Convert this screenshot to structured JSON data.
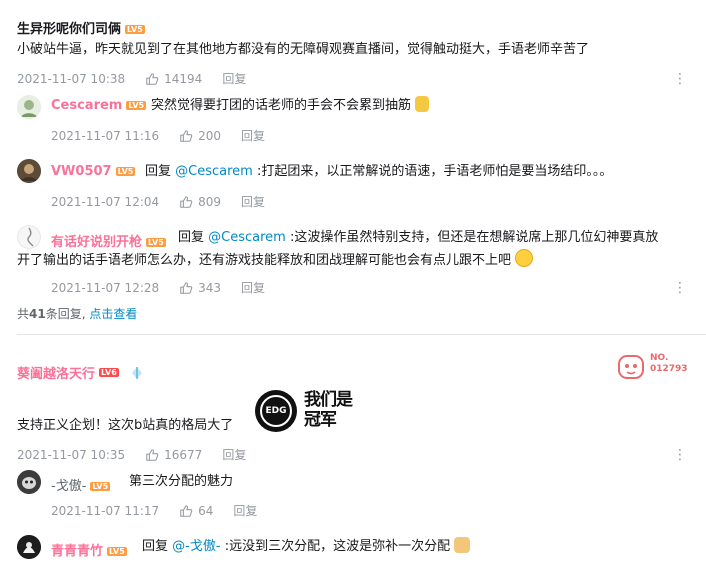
{
  "comment1": {
    "username": "生异形呢你们司俩",
    "level": "LV5",
    "text": "小破站牛逼，昨天就见到了在其他地方都没有的无障碍观赛直播间，觉得触动挺大，手语老师辛苦了",
    "time": "2021-11-07 10:38",
    "likes": "14194",
    "reply_label": "回复"
  },
  "replies1": [
    {
      "username": "Cescarem",
      "level": "LV5",
      "text": "突然觉得要打团的话老师的手会不会累到抽筋",
      "time": "2021-11-07 11:16",
      "likes": "200",
      "reply_label": "回复"
    },
    {
      "username": "VW0507",
      "level": "LV5",
      "reply_prefix": "回复",
      "at": "@Cescarem",
      "text": ":打起团来，以正常解说的语速，手语老师怕是要当场结印。。。",
      "time": "2021-11-07 12:04",
      "likes": "809",
      "reply_label": "回复"
    },
    {
      "username": "有话好说别开枪",
      "level": "LV5",
      "reply_prefix": "回复",
      "at": "@Cescarem",
      "text_line1": ":这波操作虽然特别支持，但还是在想解说席上那几位幻神要真放",
      "text_line2": "开了输出的话手语老师怎么办，还有游戏技能释放和团战理解可能也会有点儿跟不上吧",
      "time": "2021-11-07 12:28",
      "likes": "343",
      "reply_label": "回复"
    }
  ],
  "reply_summary": {
    "prefix": "共",
    "count": "41",
    "suffix": "条回复,",
    "link": "点击查看"
  },
  "comment2": {
    "username": "葵阖越洛天行",
    "level": "LV6",
    "badge_number": "NO.\n012793",
    "text": "支持正义企划！这次b站真的格局大了",
    "sticker_text": "我们是冠军",
    "sticker_logo": "EDG",
    "time": "2021-11-07 10:35",
    "likes": "16677",
    "reply_label": "回复"
  },
  "replies2": [
    {
      "username": "-戈傲-",
      "level": "LV5",
      "text": "第三次分配的魅力",
      "time": "2021-11-07 11:17",
      "likes": "64",
      "reply_label": "回复"
    },
    {
      "username": "青青青竹",
      "level": "LV5",
      "reply_prefix": "回复",
      "at": "@-戈傲-",
      "text": ":远没到三次分配，这波是弥补一次分配"
    }
  ],
  "colors": {
    "pink": "#fb7299",
    "link": "#008ac5",
    "meta": "#9499a0",
    "level_orange": "#ff9c40",
    "level_red": "#ff4b4b"
  }
}
